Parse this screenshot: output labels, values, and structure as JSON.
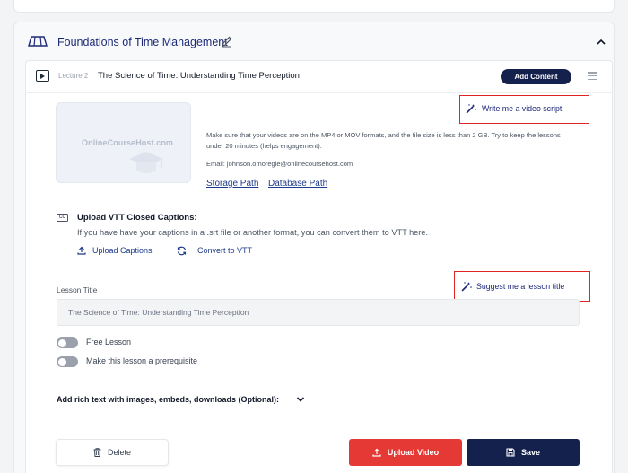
{
  "section": {
    "title": "Foundations of Time Management",
    "section_icon": "book-open-icon",
    "edit_icon": "pencil-icon",
    "collapse_icon": "chevron-up-icon"
  },
  "lecture": {
    "number_label": "Lecture 2",
    "title": "The Science of Time: Understanding Time Perception",
    "add_content_label": "Add Content",
    "play_icon": "video-play-icon",
    "menu_icon": "hamburger-icon"
  },
  "video": {
    "thumbnail_brand": "OnlineCourseHost.com",
    "info": "Make sure that your videos are on the MP4 or MOV formats, and the file size is less than 2 GB. Try to keep the lessons under 20 minutes (helps engagement).",
    "email": "Email: johnson.omoregie@onlinecoursehost.com",
    "storage_link": "Storage Path",
    "database_link": "Database Path"
  },
  "ai": {
    "write_script_label": "Write me a video script",
    "suggest_title_label": "Suggest me a lesson title",
    "highlight_color": "#e02424"
  },
  "captions": {
    "title": "Upload VTT Closed Captions:",
    "description": "If you have have your captions in a .srt file or another format, you can convert them to VTT here.",
    "upload_label": "Upload Captions",
    "convert_label": "Convert to VTT"
  },
  "lesson": {
    "title_label": "Lesson Title",
    "title_value": "The Science of Time: Understanding Time Perception",
    "free_lesson_label": "Free Lesson",
    "free_lesson_on": false,
    "prerequisite_label": "Make this lesson a prerequisite",
    "prerequisite_on": false,
    "rich_text_label": "Add rich text with images, embeds, downloads (Optional):"
  },
  "actions": {
    "delete_label": "Delete",
    "upload_video_label": "Upload Video",
    "save_label": "Save",
    "upload_color": "#e53935",
    "save_color": "#15214d"
  }
}
